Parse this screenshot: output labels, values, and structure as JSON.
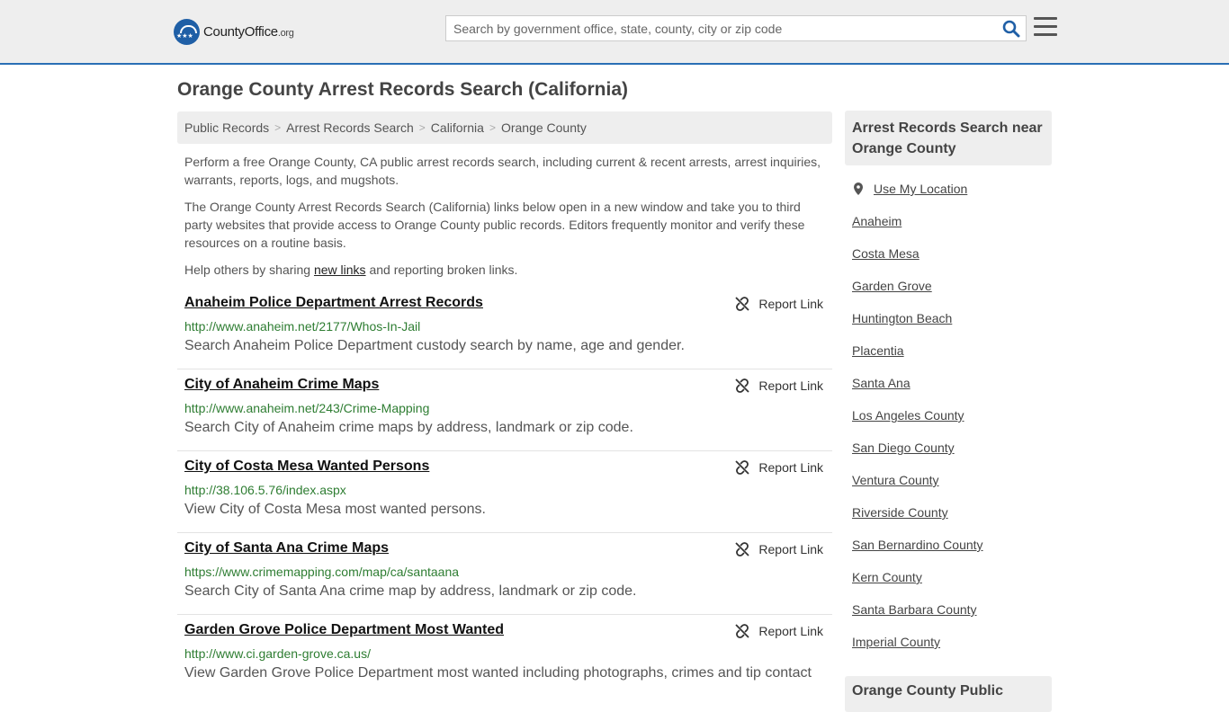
{
  "header": {
    "logo_main": "CountyOffice",
    "logo_tld": ".org",
    "search_placeholder": "Search by government office, state, county, city or zip code"
  },
  "page_title": "Orange County Arrest Records Search (California)",
  "breadcrumb": [
    "Public Records",
    "Arrest Records Search",
    "California",
    "Orange County"
  ],
  "intro": {
    "p1": "Perform a free Orange County, CA public arrest records search, including current & recent arrests, arrest inquiries, warrants, reports, logs, and mugshots.",
    "p2": "The Orange County Arrest Records Search (California) links below open in a new window and take you to third party websites that provide access to Orange County public records. Editors frequently monitor and verify these resources on a routine basis.",
    "p3_before": "Help others by sharing ",
    "p3_link": "new links",
    "p3_after": " and reporting broken links."
  },
  "report_label": "Report Link",
  "results": [
    {
      "title": "Anaheim Police Department Arrest Records",
      "url": "http://www.anaheim.net/2177/Whos-In-Jail",
      "desc": "Search Anaheim Police Department custody search by name, age and gender."
    },
    {
      "title": "City of Anaheim Crime Maps",
      "url": "http://www.anaheim.net/243/Crime-Mapping",
      "desc": "Search City of Anaheim crime maps by address, landmark or zip code."
    },
    {
      "title": "City of Costa Mesa Wanted Persons",
      "url": "http://38.106.5.76/index.aspx",
      "desc": "View City of Costa Mesa most wanted persons."
    },
    {
      "title": "City of Santa Ana Crime Maps",
      "url": "https://www.crimemapping.com/map/ca/santaana",
      "desc": "Search City of Santa Ana crime map by address, landmark or zip code."
    },
    {
      "title": "Garden Grove Police Department Most Wanted",
      "url": "http://www.ci.garden-grove.ca.us/",
      "desc": "View Garden Grove Police Department most wanted including photographs, crimes and tip contact"
    }
  ],
  "sidebar": {
    "heading": "Arrest Records Search near Orange County",
    "use_location": "Use My Location",
    "links": [
      "Anaheim",
      "Costa Mesa",
      "Garden Grove",
      "Huntington Beach",
      "Placentia",
      "Santa Ana",
      "Los Angeles County",
      "San Diego County",
      "Ventura County",
      "Riverside County",
      "San Bernardino County",
      "Kern County",
      "Santa Barbara County",
      "Imperial County"
    ],
    "heading2": "Orange County Public"
  }
}
